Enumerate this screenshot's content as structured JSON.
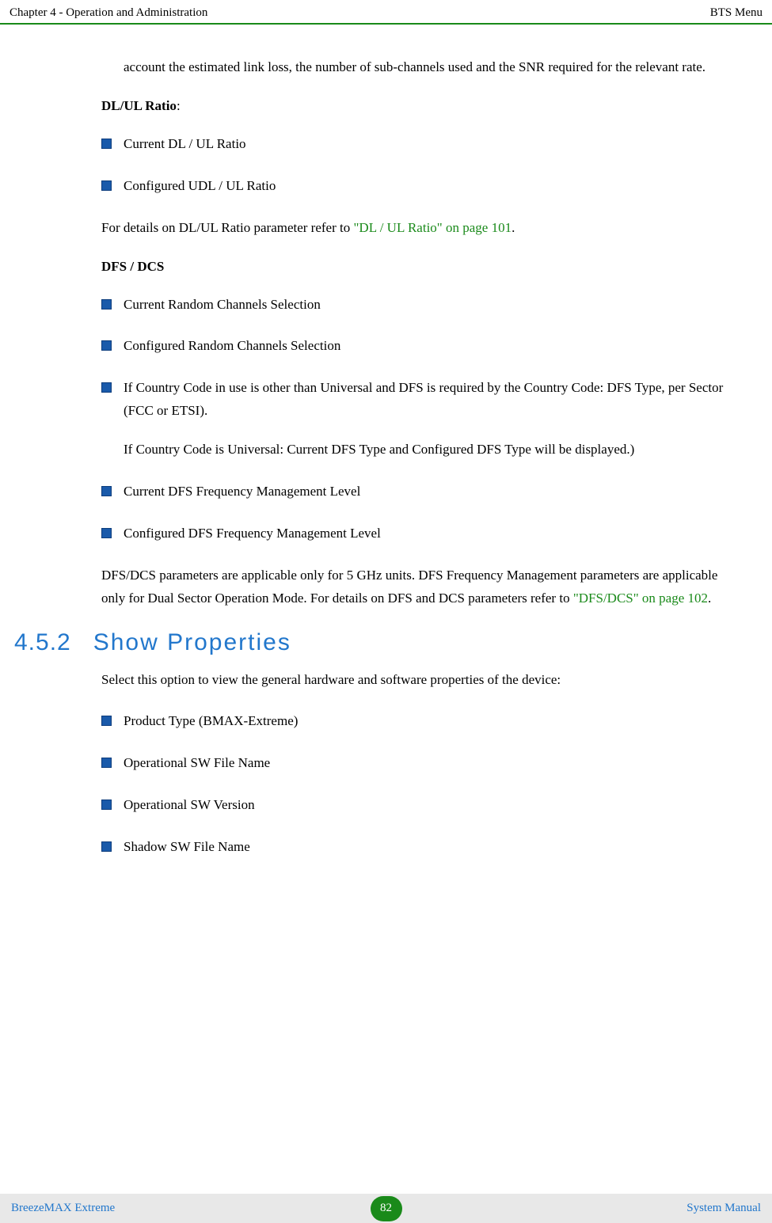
{
  "header": {
    "left": "Chapter 4 - Operation and Administration",
    "right": "BTS Menu"
  },
  "intro_continuation": "account the estimated link loss, the number of sub-channels used and the SNR required for the relevant rate.",
  "dlul": {
    "label": "DL/UL Ratio",
    "items": [
      "Current DL / UL Ratio",
      "Configured UDL / UL Ratio"
    ],
    "detail_prefix": "For details on DL/UL Ratio parameter refer to ",
    "detail_link": "\"DL / UL Ratio\" on page 101",
    "detail_suffix": "."
  },
  "dfs": {
    "label": "DFS / DCS",
    "items": [
      {
        "text": "Current Random Channels Selection"
      },
      {
        "text": "Configured Random Channels Selection"
      },
      {
        "text": "If Country Code in use is other than Universal and DFS is required by the Country Code: DFS Type, per Sector (FCC or ETSI).",
        "subtext": "If Country Code is Universal: Current DFS Type and Configured DFS Type will be displayed.)"
      },
      {
        "text": "Current DFS Frequency Management Level"
      },
      {
        "text": "Configured DFS Frequency Management Level"
      }
    ],
    "detail_prefix": "DFS/DCS parameters are applicable only for 5 GHz units. DFS Frequency Management parameters are applicable only for Dual Sector Operation Mode. For details on DFS and DCS parameters refer to ",
    "detail_link": "\"DFS/DCS\" on page 102",
    "detail_suffix": "."
  },
  "section": {
    "number": "4.5.2",
    "title": "Show Properties",
    "intro": "Select this option to view the general hardware and software properties of the device:",
    "items": [
      "Product Type (BMAX-Extreme)",
      "Operational SW File Name",
      "Operational SW Version",
      "Shadow SW File Name"
    ]
  },
  "footer": {
    "left": "BreezeMAX Extreme",
    "page": "82",
    "right": "System Manual"
  }
}
